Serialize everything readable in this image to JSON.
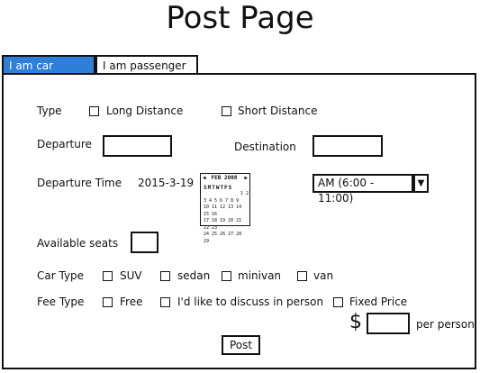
{
  "page": {
    "title": "Post Page"
  },
  "tabs": [
    {
      "label": "I am car owner",
      "active": true
    },
    {
      "label": "I am passenger",
      "active": false
    }
  ],
  "form": {
    "type": {
      "label": "Type",
      "options": [
        "Long Distance",
        "Short Distance"
      ]
    },
    "departure": {
      "label": "Departure",
      "value": ""
    },
    "destination": {
      "label": "Destination",
      "value": ""
    },
    "departure_time": {
      "label": "Departure Time",
      "date": "2015-3-19",
      "calendar": {
        "header": "FEB 2008",
        "weekdays": "SMTWTFS",
        "rows": [
          "1 2",
          "3 4 5 6 7 8 9",
          "10 11 12 13 14 15 16",
          "17 18 19 20 21 22 23",
          "24 25 26 27 28 29"
        ]
      },
      "time_slot": "AM (6:00 - 11:00)"
    },
    "available_seats": {
      "label": "Available seats",
      "value": ""
    },
    "car_type": {
      "label": "Car Type",
      "options": [
        "SUV",
        "sedan",
        "minivan",
        "van"
      ]
    },
    "fee_type": {
      "label": "Fee Type",
      "options": [
        "Free",
        "I'd like to discuss in person",
        "Fixed Price"
      ]
    },
    "price": {
      "currency": "$",
      "value": "",
      "unit": "per person"
    },
    "submit_label": "Post"
  },
  "colors": {
    "accent": "#2f7fd8",
    "border": "#111111"
  }
}
